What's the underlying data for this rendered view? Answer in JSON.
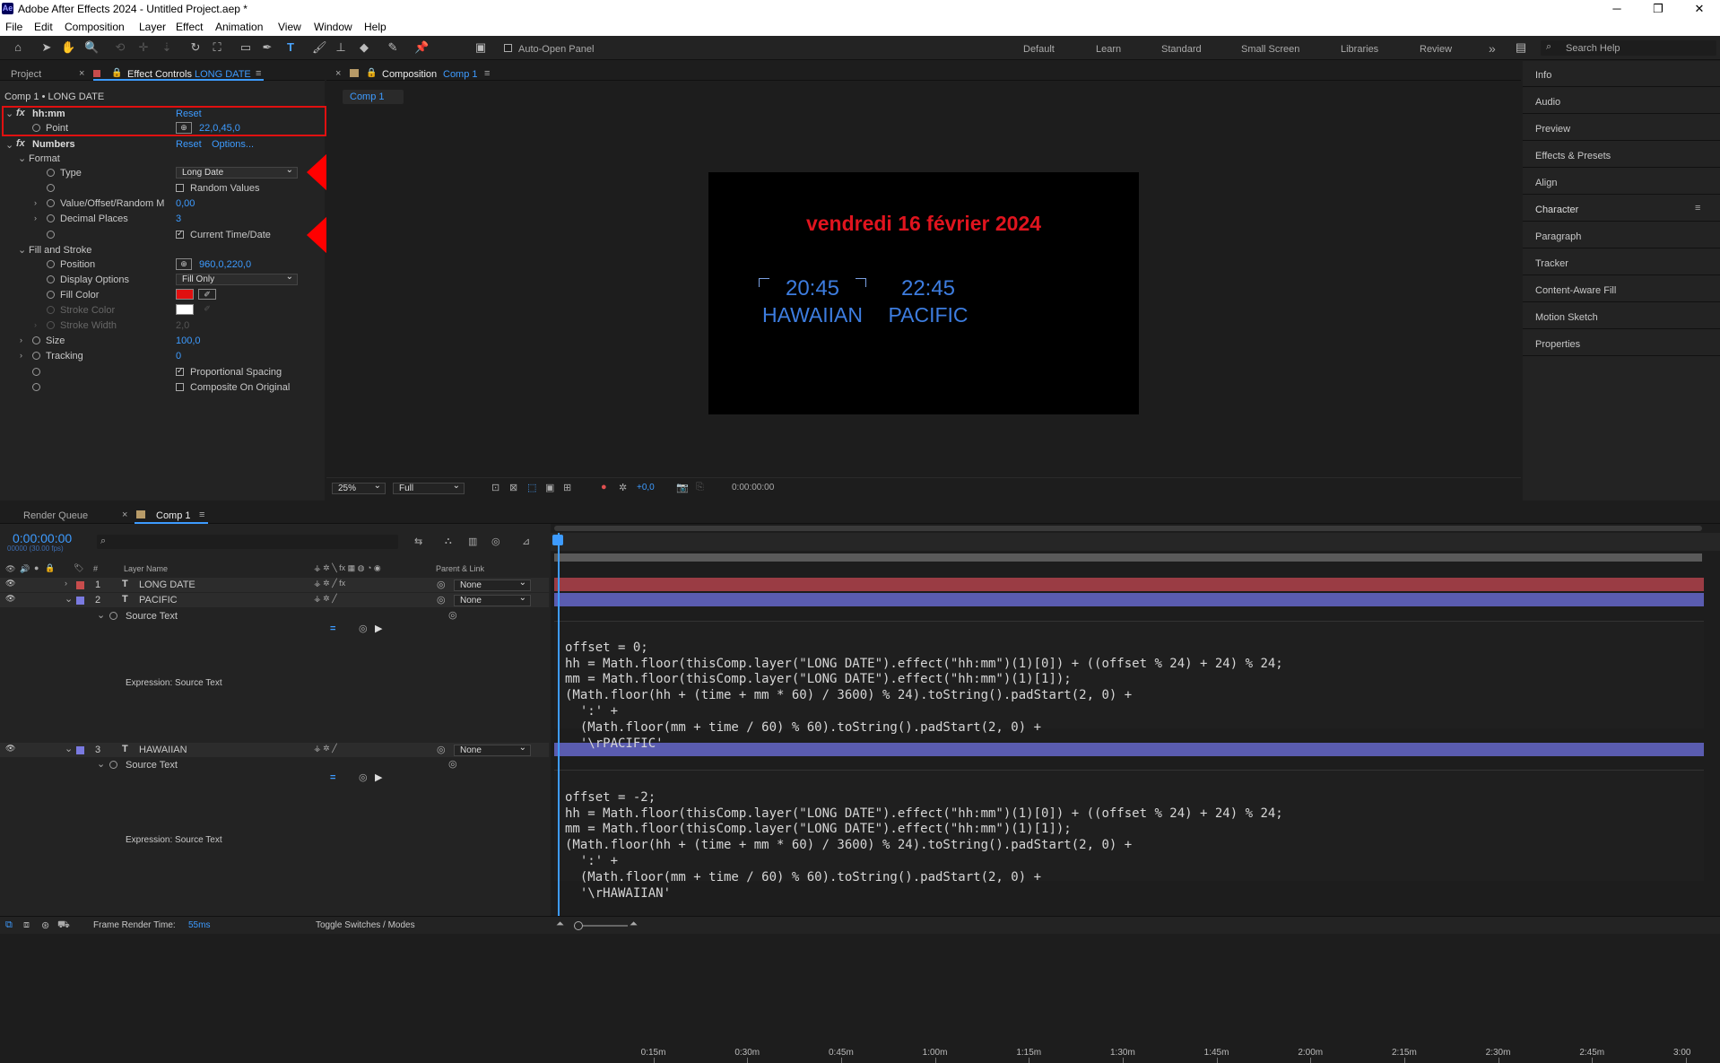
{
  "app": {
    "title": "Adobe After Effects 2024 - Untitled Project.aep *",
    "icon_text": "Ae"
  },
  "window_controls": {
    "minimize": "─",
    "restore": "❐",
    "close": "✕"
  },
  "menu": [
    "File",
    "Edit",
    "Composition",
    "Layer",
    "Effect",
    "Animation",
    "View",
    "Window",
    "Help"
  ],
  "toolbar": {
    "auto_open_panel": "Auto-Open Panel",
    "workspaces": [
      "Default",
      "Learn",
      "Standard",
      "Small Screen",
      "Libraries",
      "Review"
    ],
    "more": "»",
    "search_placeholder": "Search Help"
  },
  "left_panel": {
    "tabs": {
      "project": "Project",
      "effect_controls": "Effect Controls",
      "effect_layer": "LONG DATE"
    },
    "path": "Comp 1 • LONG DATE",
    "effect1": {
      "name": "hh:mm",
      "reset": "Reset",
      "point_label": "Point",
      "point_value": "22,0,45,0"
    },
    "effect2": {
      "name": "Numbers",
      "reset": "Reset",
      "options": "Options..."
    },
    "format_group": "Format",
    "type_label": "Type",
    "type_value": "Long Date",
    "random_values": "Random Values",
    "value_offset_label": "Value/Offset/Random M",
    "value_offset_value": "0,00",
    "decimal_label": "Decimal Places",
    "decimal_value": "3",
    "current_time": "Current Time/Date",
    "fill_stroke_group": "Fill and Stroke",
    "position_label": "Position",
    "position_value": "960,0,220,0",
    "display_label": "Display Options",
    "display_value": "Fill Only",
    "fill_color_label": "Fill Color",
    "fill_color": "#e01010",
    "stroke_color_label": "Stroke Color",
    "stroke_color": "#ffffff",
    "stroke_width_label": "Stroke Width",
    "stroke_width_value": "2,0",
    "size_label": "Size",
    "size_value": "100,0",
    "tracking_label": "Tracking",
    "tracking_value": "0",
    "proportional": "Proportional Spacing",
    "composite": "Composite On Original"
  },
  "comp_panel": {
    "tab_label": "Composition",
    "tab_comp": "Comp 1",
    "sub_tab": "Comp 1",
    "canvas": {
      "date_text": "vendredi 16 février 2024",
      "time1": "20:45",
      "city1": "HAWAIIAN",
      "time2": "22:45",
      "city2": "PACIFIC",
      "date_color": "#e0141e",
      "text_color": "#3d7de0"
    },
    "footer": {
      "zoom": "25%",
      "resolution": "Full",
      "exposure": "+0,0",
      "timecode": "0:00:00:00"
    }
  },
  "right_panel": {
    "items": [
      "Info",
      "Audio",
      "Preview",
      "Effects & Presets",
      "Align",
      "Character",
      "Paragraph",
      "Tracker",
      "Content-Aware Fill",
      "Motion Sketch",
      "Properties"
    ]
  },
  "timeline": {
    "tabs": {
      "render_queue": "Render Queue",
      "comp": "Comp 1"
    },
    "timecode": "0:00:00:00",
    "fps": "00000 (30.00 fps)",
    "columns": {
      "num": "#",
      "layer_name": "Layer Name",
      "parent": "Parent & Link"
    },
    "layers": [
      {
        "num": "1",
        "name": "LONG DATE",
        "color": "#c74c4c",
        "parent": "None"
      },
      {
        "num": "2",
        "name": "PACIFIC",
        "color": "#7a7ae0",
        "parent": "None"
      },
      {
        "num": "3",
        "name": "HAWAIIAN",
        "color": "#7a7ae0",
        "parent": "None"
      }
    ],
    "source_text": "Source Text",
    "expression_label": "Expression: Source Text",
    "ruler": [
      "0:15m",
      "0:30m",
      "0:45m",
      "1:00m",
      "1:15m",
      "1:30m",
      "1:45m",
      "2:00m",
      "2:15m",
      "2:30m",
      "2:45m",
      "3:00"
    ],
    "code_pacific": [
      "offset = 0;",
      "hh = Math.floor(thisComp.layer(\"LONG DATE\").effect(\"hh:mm\")(1)[0]) + ((offset % 24) + 24) % 24;",
      "mm = Math.floor(thisComp.layer(\"LONG DATE\").effect(\"hh:mm\")(1)[1]);",
      "(Math.floor(hh + (time + mm * 60) / 3600) % 24).toString().padStart(2, 0) +",
      "  ':' +",
      "  (Math.floor(mm + time / 60) % 60).toString().padStart(2, 0) +",
      "  '\\rPACIFIC'"
    ],
    "code_hawaiian": [
      "offset = -2;",
      "hh = Math.floor(thisComp.layer(\"LONG DATE\").effect(\"hh:mm\")(1)[0]) + ((offset % 24) + 24) % 24;",
      "mm = Math.floor(thisComp.layer(\"LONG DATE\").effect(\"hh:mm\")(1)[1]);",
      "(Math.floor(hh + (time + mm * 60) / 3600) % 24).toString().padStart(2, 0) +",
      "  ':' +",
      "  (Math.floor(mm + time / 60) % 60).toString().padStart(2, 0) +",
      "  '\\rHAWAIIAN'"
    ],
    "footer": {
      "render_time_label": "Frame Render Time:",
      "render_time": "55ms",
      "toggle": "Toggle Switches / Modes"
    }
  }
}
